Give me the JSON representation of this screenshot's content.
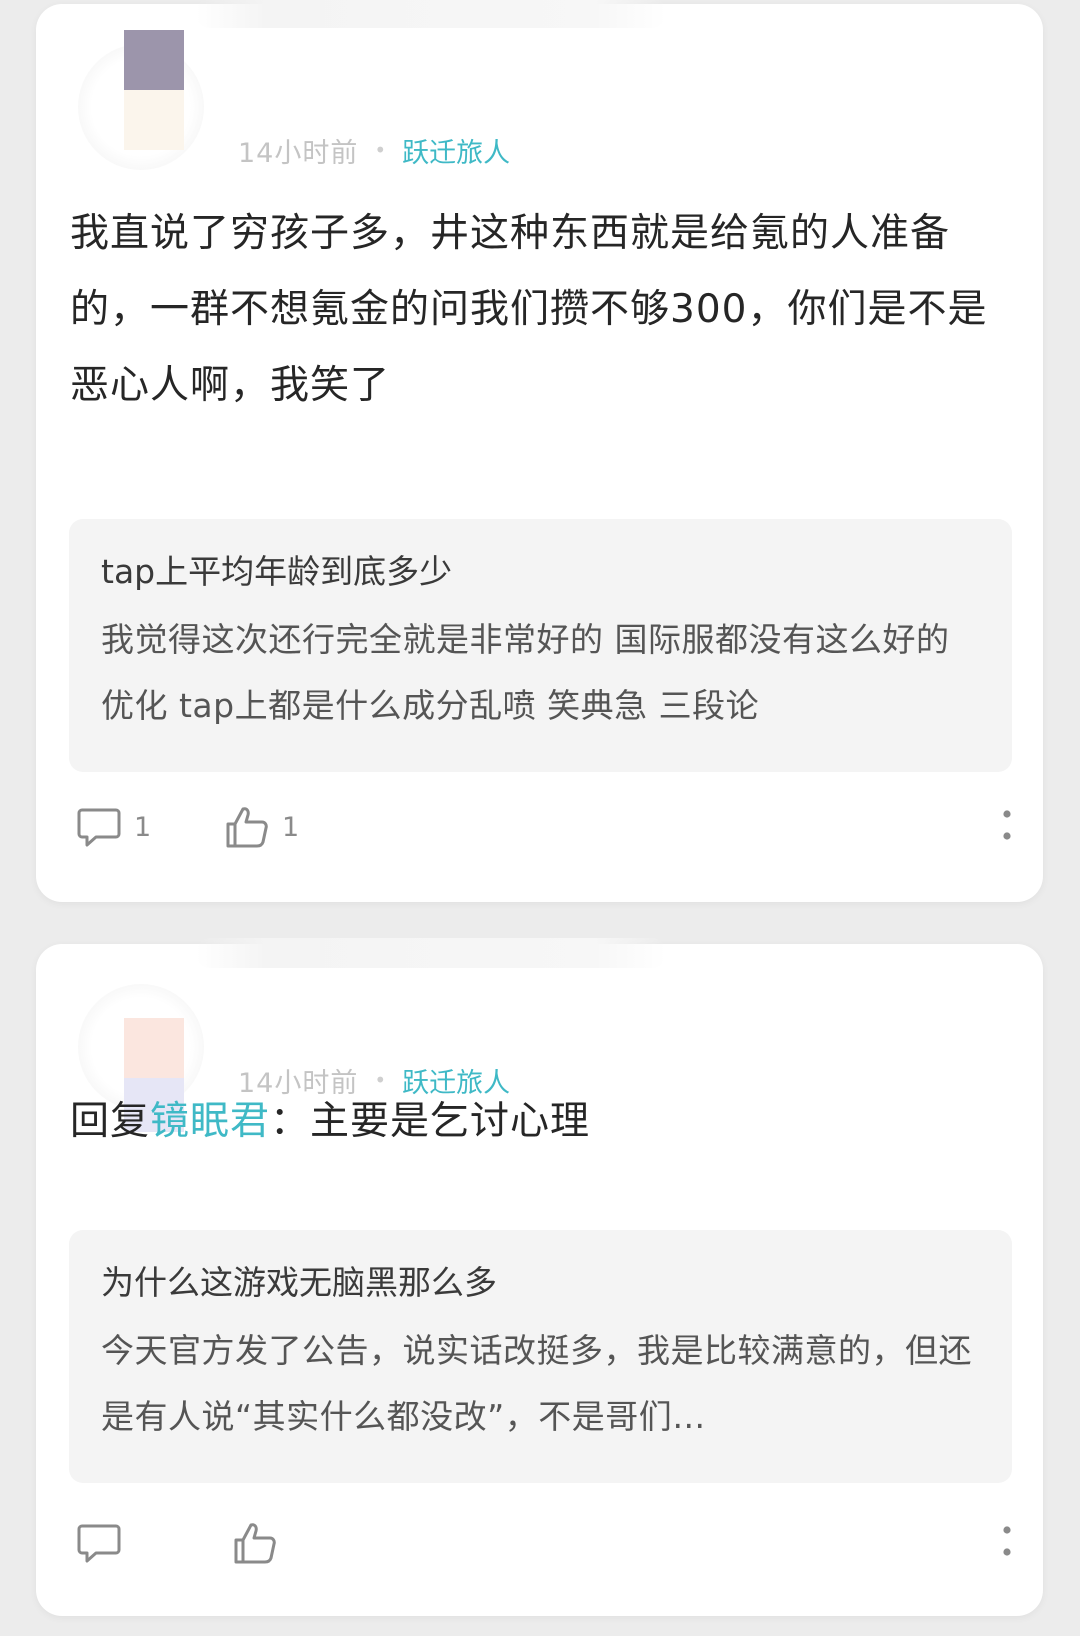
{
  "posts": [
    {
      "time": "14小时前",
      "tag": "跃迁旅人",
      "text": "我直说了穷孩子多，井这种东西就是给氪的人准备的，一群不想氪金的问我们攒不够300，你们是不是恶心人啊，我笑了",
      "quote_title": "tap上平均年龄到底多少",
      "quote_body": "我觉得这次还行完全就是非常好的 国际服都没有这么好的优化 tap上都是什么成分乱喷 笑典急 三段论",
      "comment_count": "1",
      "like_count": "1"
    },
    {
      "time": "14小时前",
      "tag": "跃迁旅人",
      "reply_prefix": "回复",
      "reply_user": "镜眠君",
      "reply_sep": "：",
      "text": "主要是乞讨心理",
      "quote_title": "为什么这游戏无脑黑那么多",
      "quote_body": "今天官方发了公告，说实话改挺多，我是比较满意的，但还是有人说“其实什么都没改”，不是哥们…"
    }
  ],
  "colors": {
    "accent": "#3fb9c6",
    "background": "#ececec",
    "card": "#ffffff",
    "quote_bg": "#f4f4f4"
  },
  "icons": [
    "comment-icon",
    "thumbs-up-icon",
    "more-vertical-icon"
  ]
}
